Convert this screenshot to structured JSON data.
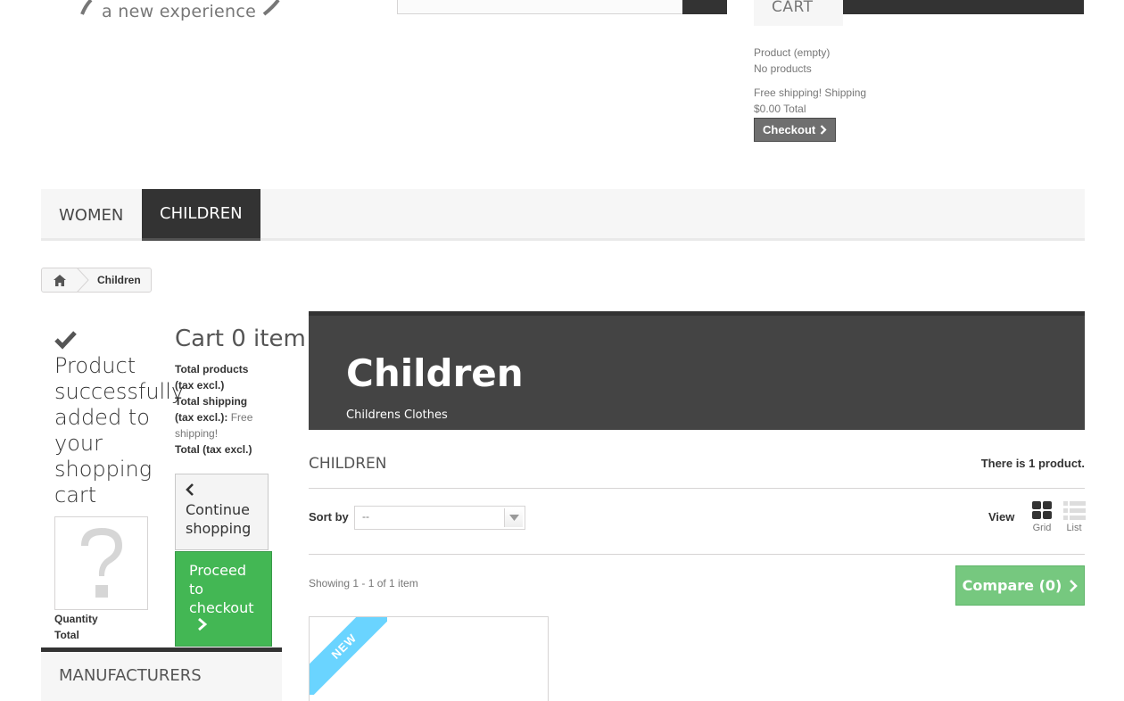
{
  "header": {
    "logo_tagline": "a new experience",
    "cart_tab_label": "CART",
    "cart_dropdown": {
      "product_line": "Product (empty)",
      "no_products": "No products",
      "shipping_line": "Free shipping! Shipping",
      "total_line": "$0.00 Total",
      "checkout_label": "Checkout"
    }
  },
  "menu": {
    "items": [
      {
        "label": "WOMEN"
      },
      {
        "label": "CHILDREN"
      }
    ]
  },
  "breadcrumb": {
    "current": "Children"
  },
  "layer_cart": {
    "success_message": "Product successfully added to your shopping cart",
    "quantity_label": "Quantity",
    "total_label": "Total",
    "cart_title": "Cart 0 item",
    "total_products_label": "Total products (tax excl.)",
    "total_shipping_label": "Total shipping (tax excl.):",
    "free_shipping": "Free shipping!",
    "total_label_2": "Total (tax excl.)",
    "continue_label": "Continue shopping",
    "proceed_label": "Proceed to checkout"
  },
  "sidebar": {
    "manufacturers_title": "MANUFACTURERS"
  },
  "category": {
    "name": "Children",
    "description": "Childrens Clothes",
    "heading": "CHILDREN",
    "product_count": "There is 1 product.",
    "sort_label": "Sort by",
    "sort_value": "--",
    "view_label": "View",
    "view_grid": "Grid",
    "view_list": "List",
    "showing": "Showing 1 - 1 of 1 item",
    "compare_label": "Compare (0)",
    "new_badge": "NEW"
  },
  "colors": {
    "dark": "#333333",
    "menu_bg": "#f6f6f6",
    "banner": "#444444",
    "proceed_green": "#43b754",
    "compare_green": "#76c87f",
    "new_ribbon": "#6ad4ff"
  }
}
